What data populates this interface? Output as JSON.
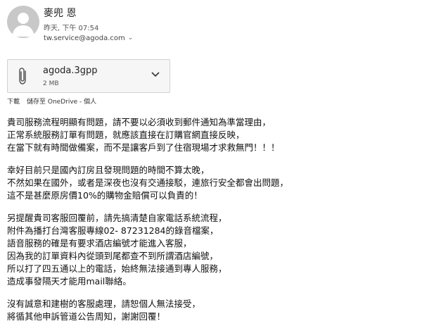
{
  "sender": {
    "name": "麥兜 恩",
    "date": "昨天, 下午 07:54",
    "recipient": "tw.service@agoda.com"
  },
  "attachment": {
    "file_name": "agoda.3gpp",
    "size": "2 MB"
  },
  "actions": {
    "download": "下載",
    "save_onedrive": "儲存至 OneDrive - 個人"
  },
  "body": {
    "p1": [
      "貴司服務流程明顯有問題，請不要以必須收到郵件通知為準當理由，",
      "正常系統服務訂單有問題，就應該直接在訂購官網直接反映，",
      "在當下就有時間做備案，而不是讓客戶到了住宿現場才求救無門！！！"
    ],
    "p2": [
      "幸好目前只是國內訂房且發現問題的時間不算太晚，",
      "不然如果在國外，或者是深夜也沒有交通接駁，連旅行安全都會出問題，",
      "這不是甚麼原房價10%的購物金賠償可以負責的！"
    ],
    "p3": [
      "另提醒貴司客服回覆前，請先搞清楚自家電話系統流程，",
      "附件為播打台灣客服專線02- 87231284的錄音檔案，",
      "語音服務的確是有要求酒店編號才能進入客服，",
      "因為我的訂單資料內從頭到尾都查不到所謂酒店編號，",
      "所以打了四五通以上的電話，始終無法接通到專人服務，",
      "造成事發隔天才能用mail聯絡。"
    ],
    "p4": [
      "沒有誠意和建樹的客服處理，請恕個人無法接受，",
      "將循其他申訴管道公告周知，謝謝回覆！"
    ]
  }
}
